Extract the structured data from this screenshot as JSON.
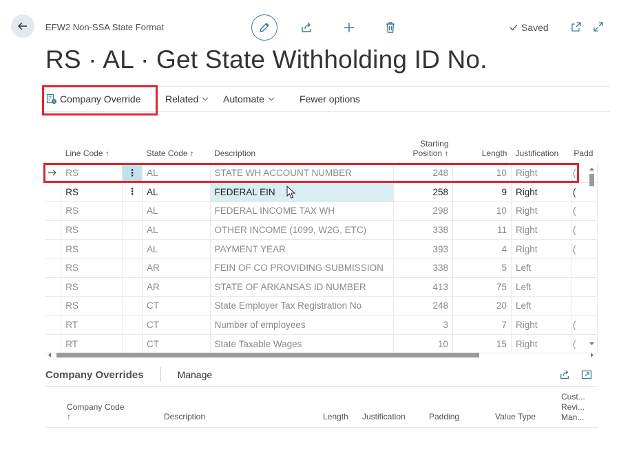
{
  "header": {
    "breadcrumb": "EFW2 Non-SSA State Format",
    "saved_label": "Saved",
    "title": "RS · AL · Get State Withholding ID No."
  },
  "actions": {
    "company_override": "Company Override",
    "related": "Related",
    "automate": "Automate",
    "fewer_options": "Fewer options"
  },
  "grid": {
    "columns": {
      "line_code": "Line Code ↑",
      "state_code": "State Code ↑",
      "description": "Description",
      "starting_position_1": "Starting",
      "starting_position_2": "Position ↑",
      "length": "Length",
      "justification": "Justification",
      "padding": "Padd"
    },
    "rows": [
      {
        "line_code": "RS",
        "state_code": "AL",
        "description": "STATE WH ACCOUNT NUMBER",
        "starting_position": "248",
        "length": "10",
        "justification": "Right",
        "padding": "("
      },
      {
        "line_code": "RS",
        "state_code": "AL",
        "description": "FEDERAL EIN",
        "starting_position": "258",
        "length": "9",
        "justification": "Right",
        "padding": "("
      },
      {
        "line_code": "RS",
        "state_code": "AL",
        "description": "FEDERAL INCOME TAX WH",
        "starting_position": "298",
        "length": "10",
        "justification": "Right",
        "padding": "("
      },
      {
        "line_code": "RS",
        "state_code": "AL",
        "description": "OTHER INCOME (1099, W2G, ETC)",
        "starting_position": "338",
        "length": "11",
        "justification": "Right",
        "padding": "("
      },
      {
        "line_code": "RS",
        "state_code": "AL",
        "description": "PAYMENT YEAR",
        "starting_position": "393",
        "length": "4",
        "justification": "Right",
        "padding": "("
      },
      {
        "line_code": "RS",
        "state_code": "AR",
        "description": "FEIN OF CO PROVIDING SUBMISSION",
        "starting_position": "338",
        "length": "5",
        "justification": "Left",
        "padding": ""
      },
      {
        "line_code": "RS",
        "state_code": "AR",
        "description": "STATE OF ARKANSAS ID NUMBER",
        "starting_position": "413",
        "length": "75",
        "justification": "Left",
        "padding": ""
      },
      {
        "line_code": "RS",
        "state_code": "CT",
        "description": "State Employer Tax Registration No",
        "starting_position": "248",
        "length": "20",
        "justification": "Left",
        "padding": ""
      },
      {
        "line_code": "RT",
        "state_code": "CT",
        "description": "Number of employees",
        "starting_position": "3",
        "length": "7",
        "justification": "Right",
        "padding": "("
      },
      {
        "line_code": "RT",
        "state_code": "CT",
        "description": "State Taxable Wages",
        "starting_position": "10",
        "length": "15",
        "justification": "Right",
        "padding": "("
      }
    ]
  },
  "subpage": {
    "title": "Company Overrides",
    "manage": "Manage",
    "columns": {
      "company_code": "Company Code",
      "company_code_sort": "↑",
      "description": "Description",
      "length": "Length",
      "justification": "Justification",
      "padding": "Padding",
      "value_type": "Value Type",
      "custom_1": "Cust...",
      "custom_2": "Revi...",
      "custom_3": "Man..."
    }
  },
  "icons": {
    "back": "back-arrow-icon",
    "edit": "pencil-icon",
    "share": "share-icon",
    "new": "plus-icon",
    "delete": "trash-icon",
    "saved": "checkmark-icon",
    "open_new_window": "open-new-window-icon",
    "expand": "expand-icon",
    "company_override": "company-override-icon"
  },
  "colors": {
    "accent": "#3e7c8c",
    "highlight": "#e0252c",
    "selected_cell": "#d9eef2"
  }
}
